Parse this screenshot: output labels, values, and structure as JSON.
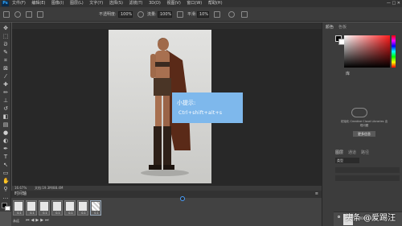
{
  "menubar": {
    "logo": "Ps",
    "menus": [
      "文件(F)",
      "编辑(E)",
      "图像(I)",
      "图层(L)",
      "文字(Y)",
      "选择(S)",
      "滤镜(T)",
      "3D(D)",
      "视图(V)",
      "窗口(W)",
      "帮助(H)"
    ],
    "window_buttons": "—  □  ✕"
  },
  "options": {
    "opacity_label": "不透明度:",
    "opacity_value": "100%",
    "flow_label": "流量:",
    "flow_value": "100%",
    "smoothing_label": "平滑:",
    "smoothing_value": "10%"
  },
  "status": {
    "zoom": "16.67%",
    "doc": "文档:19.3M/88.4M"
  },
  "timeline": {
    "title": "时间轴",
    "frames": [
      {
        "dur": "0.1"
      },
      {
        "dur": "0.1"
      },
      {
        "dur": "0.1"
      },
      {
        "dur": "0.1"
      },
      {
        "dur": "0.1"
      },
      {
        "dur": "0.1"
      },
      {
        "dur": "0.1"
      }
    ],
    "loop": "永远"
  },
  "tip": {
    "title": "小提示:",
    "shortcut": "Ctrl+shift+alt+s"
  },
  "right_panel": {
    "color_tab": "颜色",
    "swatches_tab": "色板",
    "libraries_tab": "库",
    "libraries_msg": "初始化 Creative Cloud Libraries 出现问题",
    "libraries_link": "更多信息",
    "layers_tab": "图层",
    "channels_tab": "通道",
    "paths_tab": "路径",
    "layer_kind": "类型",
    "layer_name": "1_00002.tif"
  },
  "watermark": "头条 @爱踢汪",
  "colors": {
    "accent": "#31a8ff",
    "tip_bg": "#7eb8ec"
  }
}
